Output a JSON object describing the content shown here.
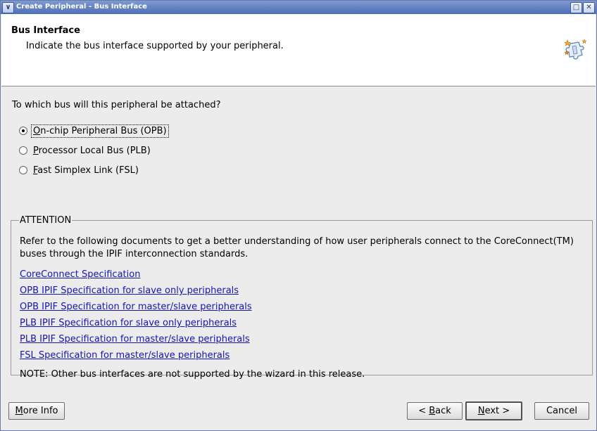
{
  "window": {
    "title": "Create Peripheral - Bus Interface",
    "menu_glyph": "∨",
    "minimize_glyph": "□",
    "close_glyph": "✕"
  },
  "header": {
    "title": "Bus Interface",
    "subtitle": "Indicate the bus interface supported by your peripheral."
  },
  "question": "To which bus will this peripheral be attached?",
  "options": [
    {
      "mnemonic": "O",
      "rest": "n-chip Peripheral Bus (OPB)",
      "selected": true
    },
    {
      "mnemonic": "P",
      "rest": "rocessor Local Bus (PLB)",
      "selected": false
    },
    {
      "mnemonic": "F",
      "rest": "ast Simplex Link (FSL)",
      "selected": false
    }
  ],
  "attention": {
    "legend": "ATTENTION",
    "text": "Refer to the following documents to get a better understanding of how user peripherals connect to the CoreConnect(TM) buses through the IPIF interconnection standards.",
    "links": [
      "CoreConnect Specification",
      "OPB IPIF Specification for slave only peripherals",
      "OPB IPIF Specification for master/slave peripherals",
      "PLB IPIF Specification for slave only peripherals",
      "PLB IPIF Specification for master/slave peripherals",
      "FSL Specification for master/slave peripherals"
    ],
    "note": "NOTE: Other bus interfaces are not supported by the wizard in this release."
  },
  "buttons": {
    "more_info": {
      "mnemonic": "M",
      "rest": "ore Info"
    },
    "back": {
      "prefix": "< ",
      "mnemonic": "B",
      "rest": "ack"
    },
    "next": {
      "mnemonic": "N",
      "rest": "ext >"
    },
    "cancel": "Cancel"
  }
}
